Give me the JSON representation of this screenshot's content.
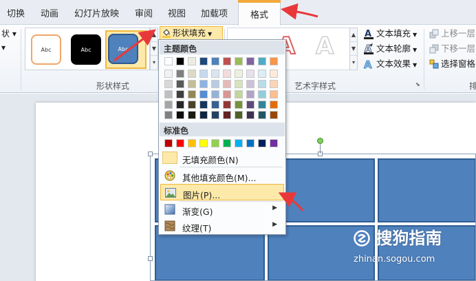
{
  "tabs": [
    {
      "label": "切换"
    },
    {
      "label": "动画"
    },
    {
      "label": "幻灯片放映"
    },
    {
      "label": "审阅"
    },
    {
      "label": "视图"
    },
    {
      "label": "加载项"
    }
  ],
  "active_tab": "格式",
  "left_items": [
    "状 ▾",
    "▾"
  ],
  "shape_styles": {
    "thumb1": "Abc",
    "thumb2": "Abc",
    "thumb3": "Abc",
    "group_label": "形状样式",
    "fill_button": "形状填充"
  },
  "wordart": {
    "letter1": "A",
    "letter2": "A",
    "text_fill": "文本填充",
    "text_outline": "文本轮廓",
    "text_effect": "文本效果",
    "group_label": "艺术字样式"
  },
  "arrange": {
    "bring_forward": "上移一层",
    "send_backward": "下移一层",
    "selection_pane": "选择窗格",
    "group_label": "排"
  },
  "menu": {
    "theme_colors_label": "主题颜色",
    "standard_colors_label": "标准色",
    "theme_top_row": [
      "#ffffff",
      "#000000",
      "#eeece1",
      "#1f497d",
      "#4f81bd",
      "#c0504d",
      "#9bbb59",
      "#8064a2",
      "#4bacc6",
      "#f79646"
    ],
    "theme_shades": [
      [
        "#f2f2f2",
        "#7f7f7f",
        "#ddd9c3",
        "#c6d9f0",
        "#dbe5f1",
        "#f2dcdb",
        "#ebf1dd",
        "#e5e0ec",
        "#dbeef3",
        "#fdeada"
      ],
      [
        "#d8d8d8",
        "#595959",
        "#c4bd97",
        "#8db3e2",
        "#b8cce4",
        "#e5b9b7",
        "#d7e3bc",
        "#ccc1d9",
        "#b7dde8",
        "#fbd5b5"
      ],
      [
        "#bfbfbf",
        "#3f3f3f",
        "#938953",
        "#548dd4",
        "#95b3d7",
        "#d99694",
        "#c3d69b",
        "#b2a2c7",
        "#92cddc",
        "#fac08f"
      ],
      [
        "#a5a5a5",
        "#262626",
        "#494429",
        "#17365d",
        "#366092",
        "#953734",
        "#76923c",
        "#5f497a",
        "#31859b",
        "#e36c09"
      ],
      [
        "#7f7f7f",
        "#0c0c0c",
        "#1d1b10",
        "#0f243e",
        "#244061",
        "#632423",
        "#4f6128",
        "#3f3151",
        "#205867",
        "#974806"
      ]
    ],
    "standard_colors": [
      "#c00000",
      "#ff0000",
      "#ffc000",
      "#ffff00",
      "#92d050",
      "#00b050",
      "#00b0f0",
      "#0070c0",
      "#002060",
      "#7030a0"
    ],
    "no_fill": "无填充颜色(N)",
    "more_colors": "其他填充颜色(M)...",
    "picture": "图片(P)...",
    "gradient": "渐变(G)",
    "texture": "纹理(T)"
  },
  "watermark": {
    "brand": "搜狗指南",
    "url": "zhinan.sogou.com"
  },
  "colors": {
    "accent_orange": "#f2a93b",
    "highlight": "#fde9a9",
    "shape_blue": "#4f81bd",
    "annotation_red": "#e8393a"
  }
}
